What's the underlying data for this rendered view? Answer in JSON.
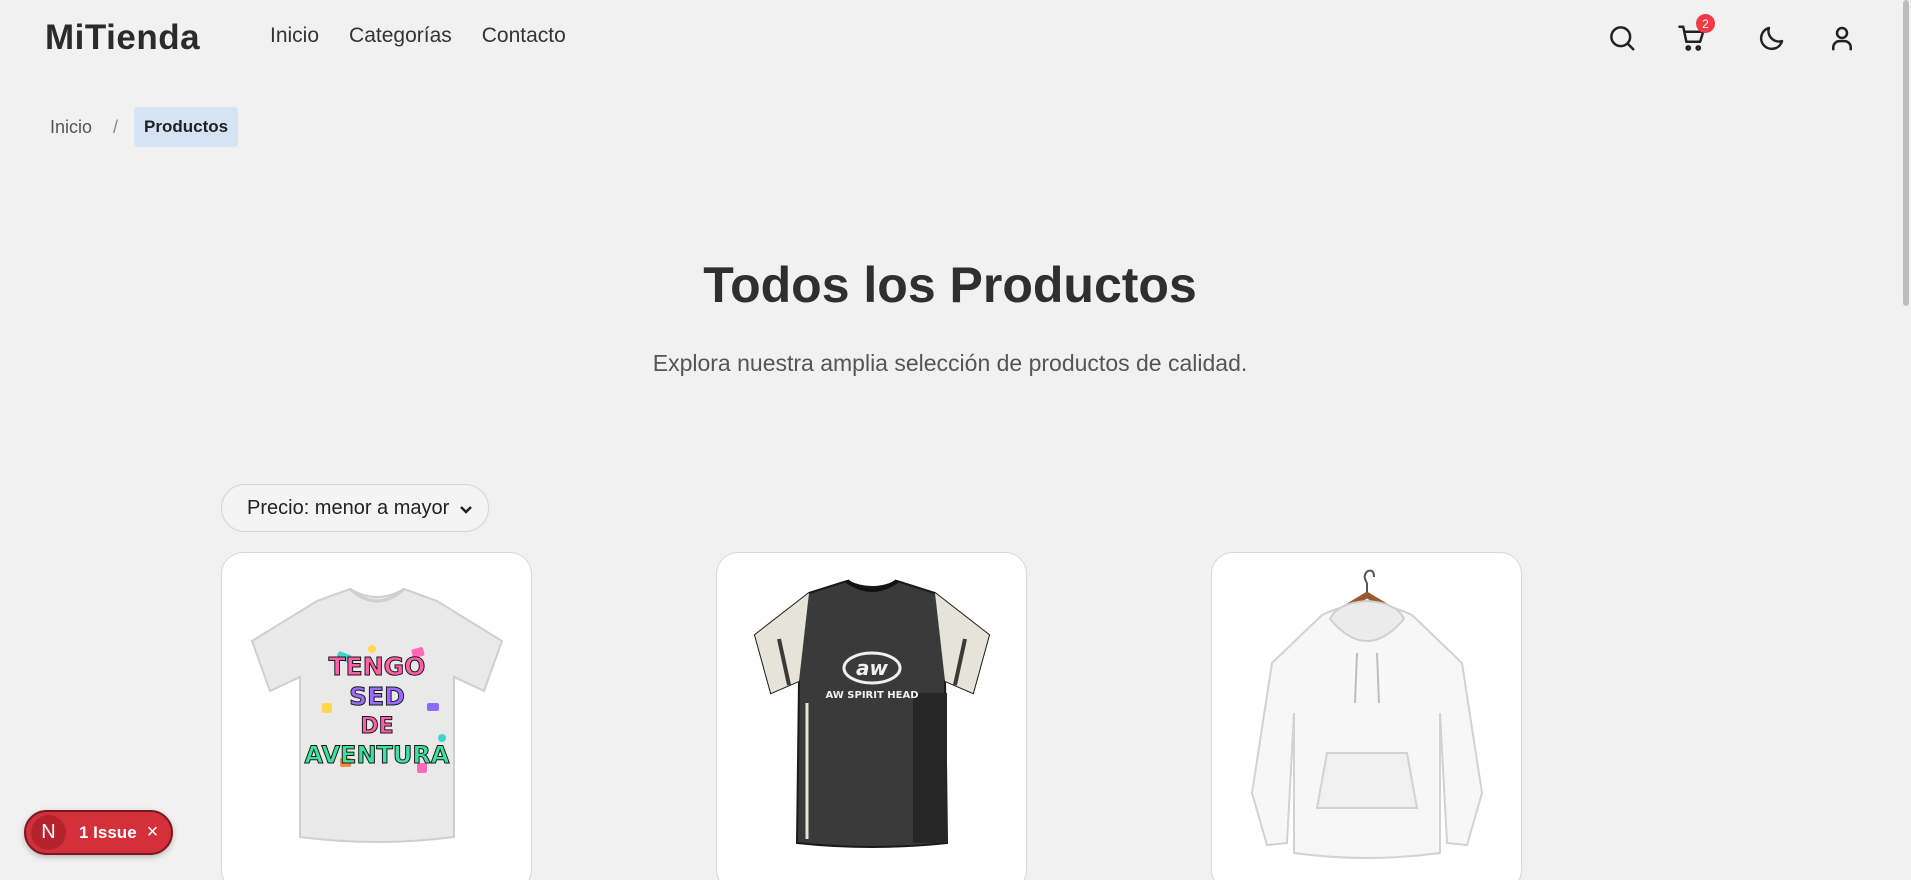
{
  "header": {
    "logo": "MiTienda",
    "nav": [
      "Inicio",
      "Categorías",
      "Contacto"
    ],
    "icons": [
      "search-icon",
      "cart-icon",
      "moon-icon",
      "user-icon"
    ],
    "cart_count": "2"
  },
  "breadcrumb": {
    "home": "Inicio",
    "separator": "/",
    "current": "Productos"
  },
  "hero": {
    "title": "Todos los Productos",
    "subtitle": "Explora nuestra amplia selección de productos de calidad."
  },
  "sort": {
    "selected": "Precio: menor a mayor"
  },
  "products": [
    {
      "image": "white t-shirt with colorful graphic",
      "graphic_text": [
        "TENGO",
        "SED",
        "DE",
        "AVENTURA"
      ]
    },
    {
      "image": "black and white jersey t-shirt",
      "graphic_text": [
        "aw",
        "AW SPIRIT HEAD"
      ]
    },
    {
      "image": "white hoodie on hanger"
    }
  ],
  "dev_indicator": {
    "letter": "N",
    "label": "1 Issue",
    "close": "×"
  },
  "colors": {
    "background": "#f1f1f1",
    "badge": "#ef3b46",
    "breadcrumb_active": "#d5e3f5",
    "issue_pill": "#d4303b"
  }
}
